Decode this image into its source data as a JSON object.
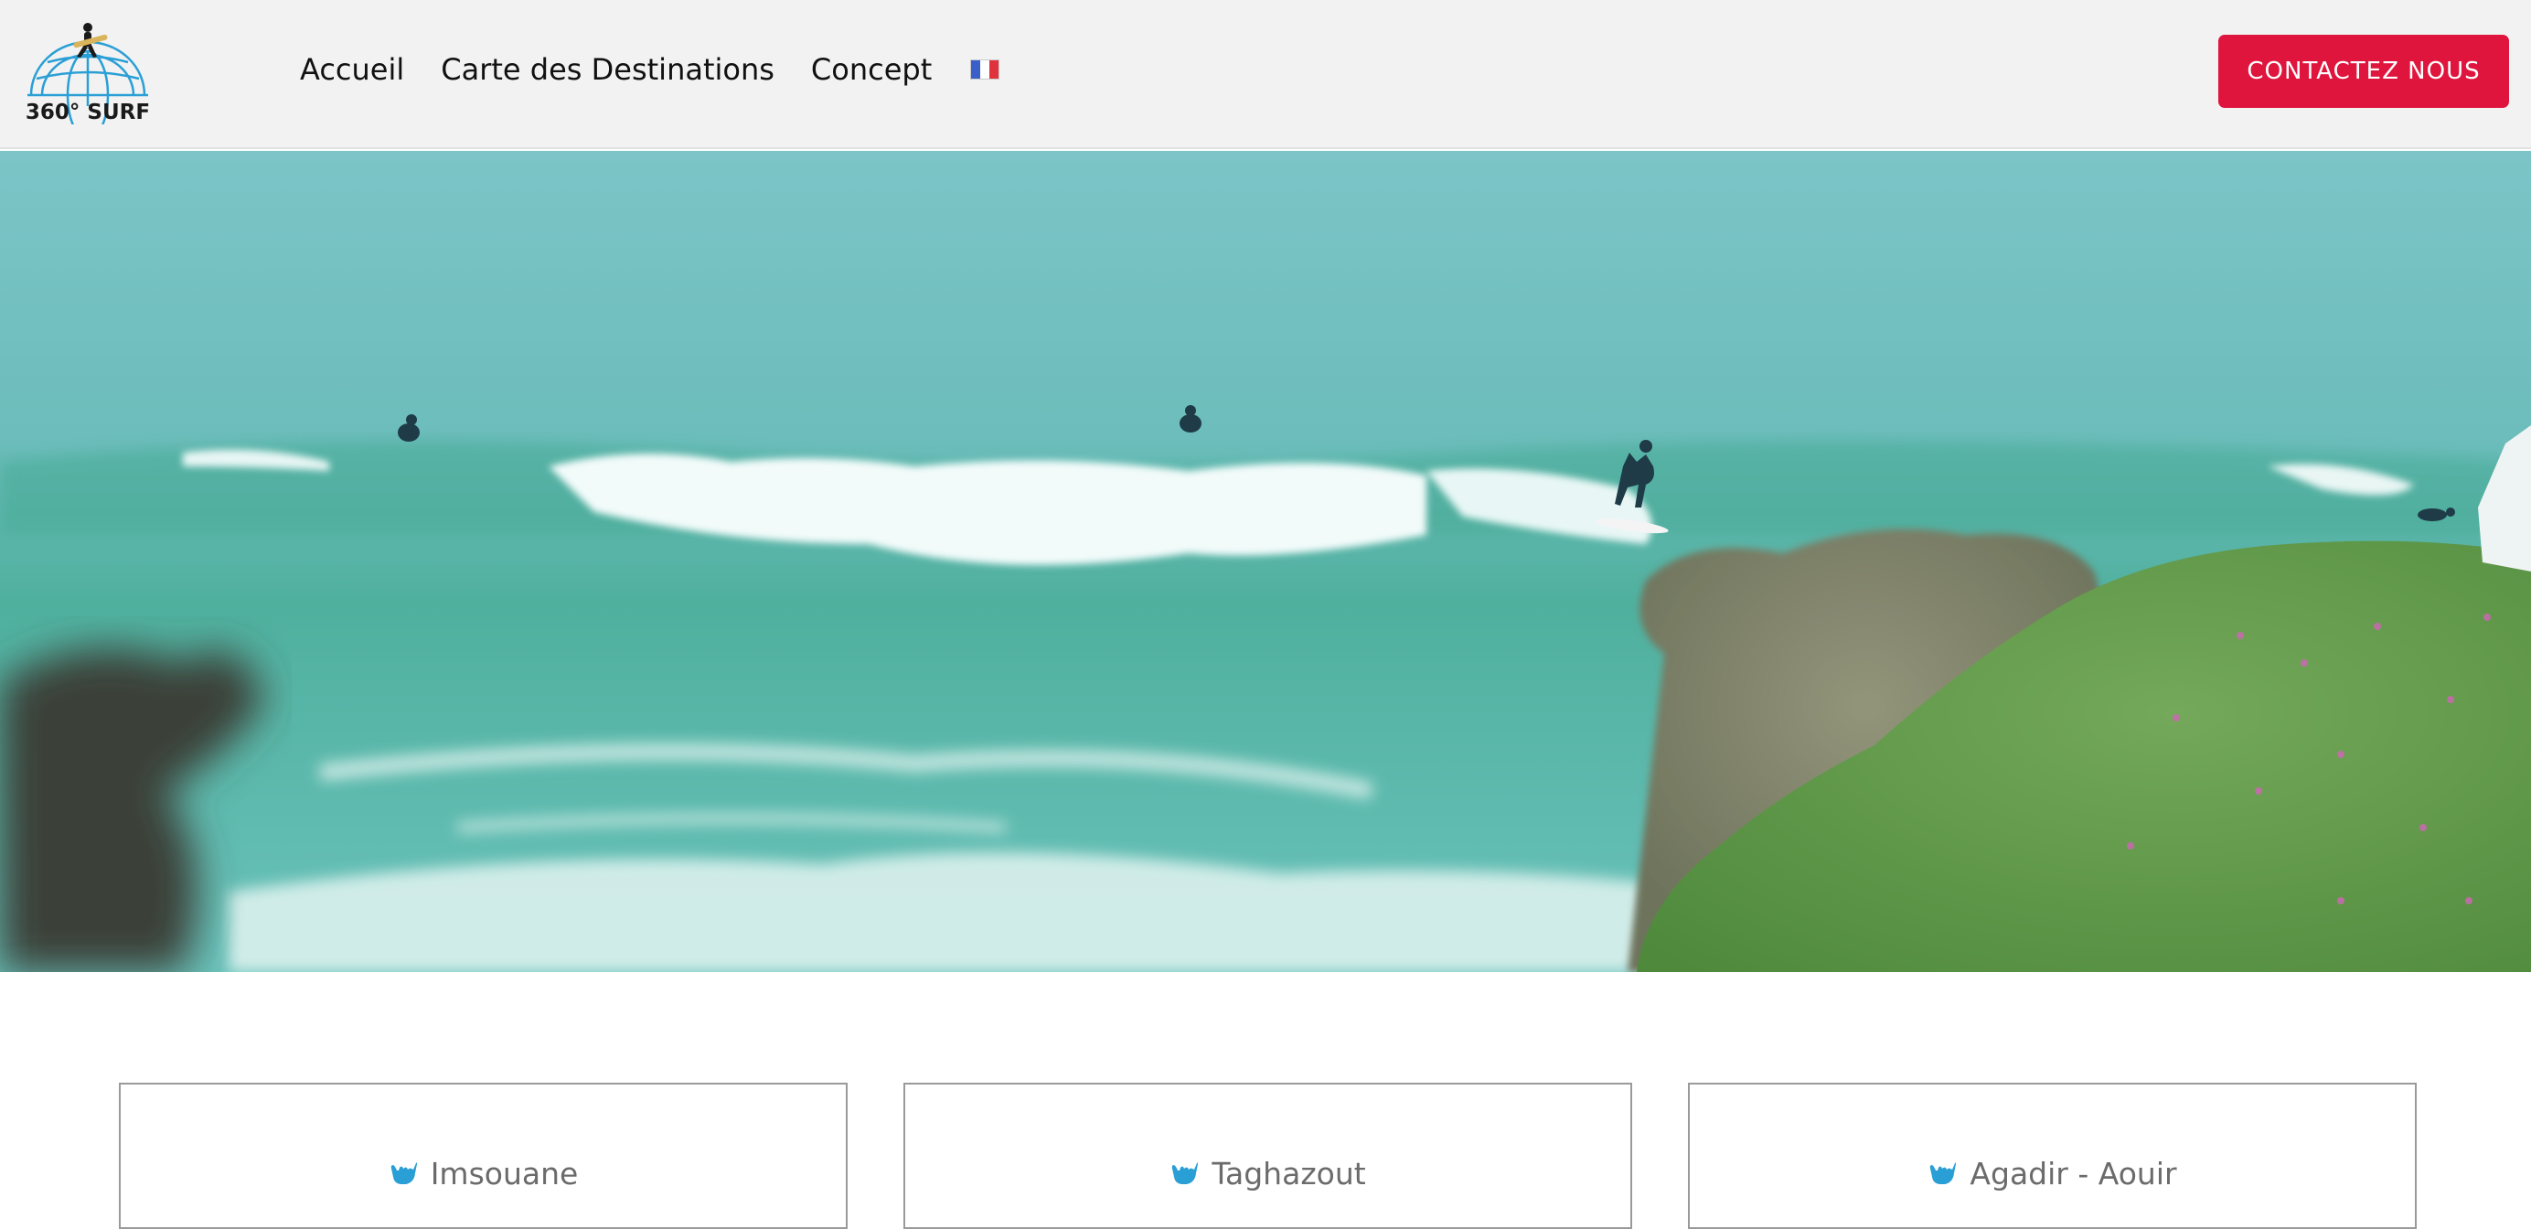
{
  "header": {
    "logo_text": "360° SURF",
    "nav": [
      {
        "label": "Accueil"
      },
      {
        "label": "Carte des Destinations"
      },
      {
        "label": "Concept"
      }
    ],
    "language_flag": {
      "icon": "french-flag-icon",
      "colors": [
        "#3a5fc8",
        "#ffffff",
        "#e0323c"
      ]
    },
    "cta_label": "CONTACTEZ NOUS"
  },
  "hero": {
    "image": "surf-spot-photo",
    "description_icon": "surfers-on-wave"
  },
  "destinations": [
    {
      "label": "Imsouane",
      "icon": "shaka-hand-icon"
    },
    {
      "label": "Taghazout",
      "icon": "shaka-hand-icon"
    },
    {
      "label": "Agadir - Aouir",
      "icon": "shaka-hand-icon"
    }
  ],
  "colors": {
    "accent": "#e0153d",
    "header_bg": "#f2f2f2",
    "icon_blue": "#2a9fd6",
    "card_text": "#6b6b6b"
  }
}
